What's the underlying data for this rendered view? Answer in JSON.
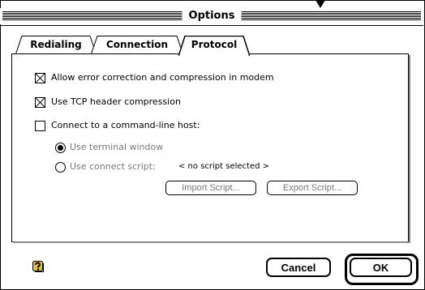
{
  "window": {
    "title": "Options"
  },
  "tabs": [
    {
      "label": "Redialing",
      "active": false
    },
    {
      "label": "Connection",
      "active": false
    },
    {
      "label": "Protocol",
      "active": true
    }
  ],
  "protocol": {
    "error_correction": {
      "label": "Allow error correction and compression in modem",
      "checked": true
    },
    "tcp_compression": {
      "label": "Use TCP header compression",
      "checked": true
    },
    "command_line_host": {
      "label": "Connect to a command-line host:",
      "checked": false
    },
    "terminal_window": {
      "label": "Use terminal window",
      "selected": true,
      "enabled": false
    },
    "connect_script": {
      "label": "Use connect script:",
      "selected": false,
      "enabled": false,
      "value": "< no script selected >"
    },
    "import_button": {
      "label": "Import Script...",
      "enabled": false
    },
    "export_button": {
      "label": "Export Script...",
      "enabled": false
    }
  },
  "footer": {
    "help_icon": "help-question-icon",
    "cancel_label": "Cancel",
    "ok_label": "OK"
  }
}
